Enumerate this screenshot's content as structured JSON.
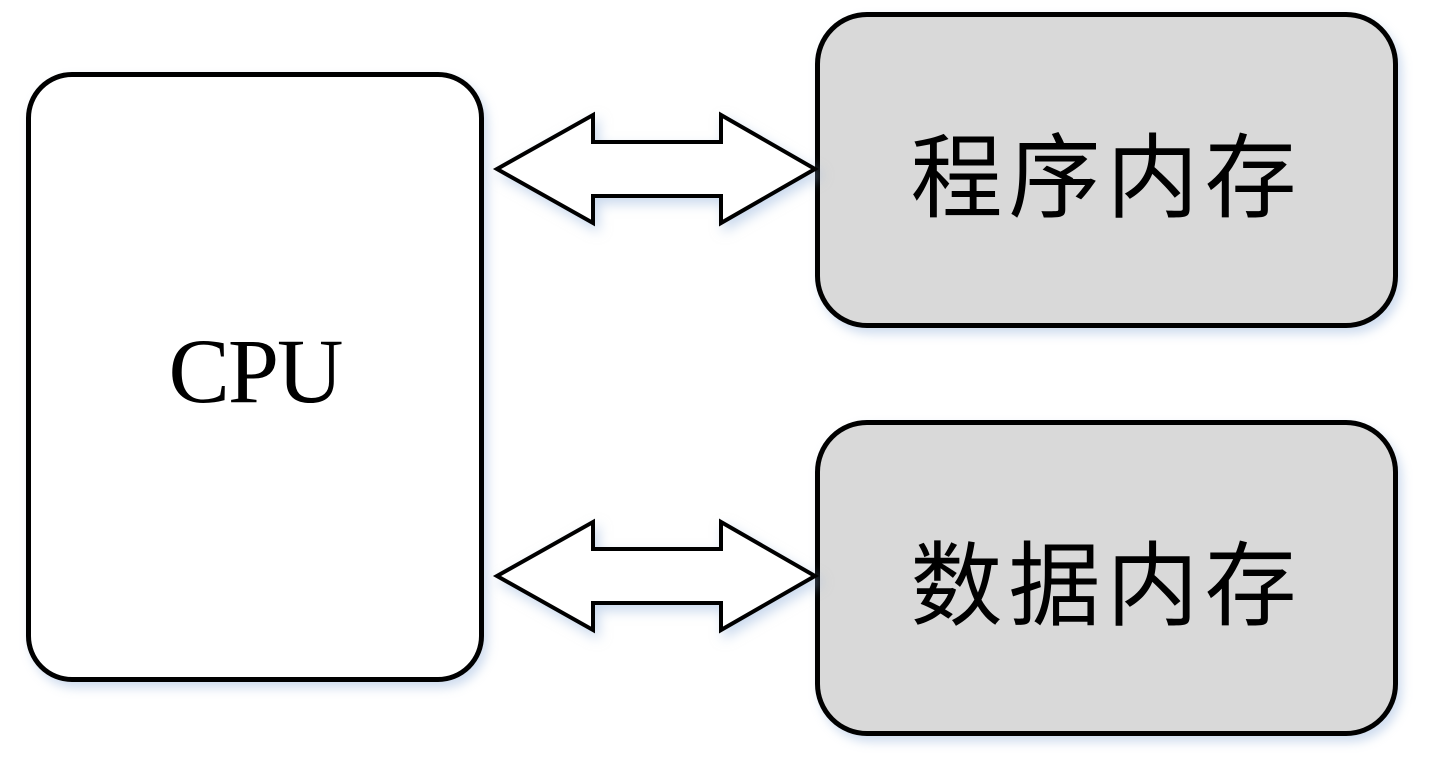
{
  "cpu": {
    "label": "CPU"
  },
  "program_memory": {
    "label": "程序内存"
  },
  "data_memory": {
    "label": "数据内存"
  },
  "colors": {
    "cpu_fill": "#ffffff",
    "memory_fill": "#d9d9d9",
    "outline": "#000000",
    "shadow": "#b4c8e6"
  }
}
